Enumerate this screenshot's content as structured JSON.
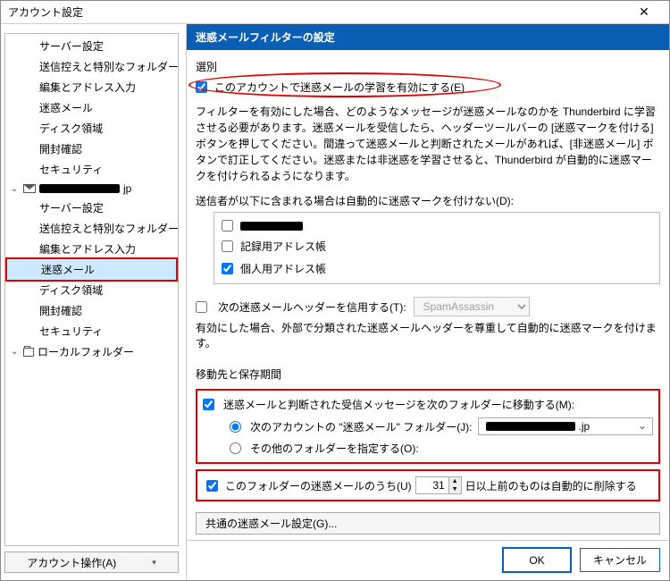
{
  "window": {
    "title": "アカウント設定"
  },
  "sidebar": {
    "items": [
      {
        "label": "サーバー設定"
      },
      {
        "label": "送信控えと特別なフォルダー"
      },
      {
        "label": "編集とアドレス入力"
      },
      {
        "label": "迷惑メール"
      },
      {
        "label": "ディスク領域"
      },
      {
        "label": "開封確認"
      },
      {
        "label": "セキュリティ"
      }
    ],
    "account_suffix": "jp",
    "sub_items": [
      {
        "label": "サーバー設定"
      },
      {
        "label": "送信控えと特別なフォルダー"
      },
      {
        "label": "編集とアドレス入力"
      },
      {
        "label": "迷惑メール",
        "selected": true
      },
      {
        "label": "ディスク領域"
      },
      {
        "label": "開封確認"
      },
      {
        "label": "セキュリティ"
      }
    ],
    "local_folders": "ローカルフォルダー",
    "account_ops": "アカウント操作(A)"
  },
  "main": {
    "banner": "迷惑メールフィルターの設定",
    "section_selection": "選別",
    "enable_learning": "このアカウントで迷惑メールの学習を有効にする(E)",
    "desc": "フィルターを有効にした場合、どのようなメッセージが迷惑メールなのかを Thunderbird に学習させる必要があります。迷惑メールを受信したら、ヘッダーツールバーの [迷惑マークを付ける] ボタンを押してください。間違って迷惑メールと判断されたメールがあれば、[非迷惑メール] ボタンで訂正してください。迷惑または非迷惑を学習させると、Thunderbird が自動的に迷惑マークを付けられるようになります。",
    "whitelist_label": "送信者が以下に含まれる場合は自動的に迷惑マークを付けない(D):",
    "ab_items": [
      {
        "label": "",
        "redacted": true,
        "checked": false
      },
      {
        "label": "記録用アドレス帳",
        "checked": false
      },
      {
        "label": "個人用アドレス帳",
        "checked": true
      }
    ],
    "trust_header": "次の迷惑メールヘッダーを信用する(T):",
    "trust_select": "SpamAssassin",
    "trust_desc": "有効にした場合、外部で分類された迷惑メールヘッダーを尊重して自動的に迷惑マークを付けます。",
    "section_move": "移動先と保存期間",
    "move_enable": "迷惑メールと判断された受信メッセージを次のフォルダーに移動する(M):",
    "move_opt1": "次のアカウントの \"迷惑メール\" フォルダー(J):",
    "move_combo_suffix": ".jp",
    "move_opt2": "その他のフォルダーを指定する(O):",
    "retain_label_pre": "このフォルダーの迷惑メールのうち(U)",
    "retain_days": "31",
    "retain_label_post": "日以上前のものは自動的に削除する",
    "global_button": "共通の迷惑メール設定(G)...",
    "ok": "OK",
    "cancel": "キャンセル"
  }
}
